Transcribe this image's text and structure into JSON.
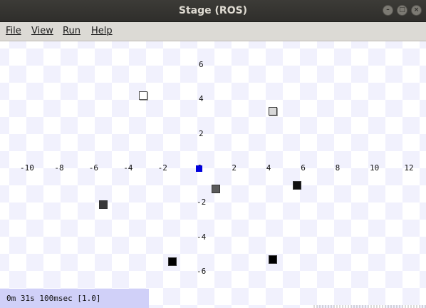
{
  "window": {
    "title": "Stage (ROS)"
  },
  "menu": [
    "File",
    "View",
    "Run",
    "Help"
  ],
  "axes": {
    "x_ticks": [
      -10,
      -8,
      -6,
      -4,
      -2,
      0,
      2,
      4,
      6,
      8,
      10,
      12
    ],
    "y_ticks": [
      6,
      4,
      2,
      -2,
      -4,
      -6
    ]
  },
  "robot": {
    "x": 0,
    "y": 0,
    "color": "#0000dd"
  },
  "objects": [
    {
      "x": -3.3,
      "y": 4.2,
      "color": "#ffffff"
    },
    {
      "x": 4.2,
      "y": 3.3,
      "color": "#d8d8d8"
    },
    {
      "x": 0.9,
      "y": -1.2,
      "color": "#5a5a5a"
    },
    {
      "x": 5.6,
      "y": -1.0,
      "color": "#111111"
    },
    {
      "x": -5.6,
      "y": -2.1,
      "color": "#3a3a3a"
    },
    {
      "x": -1.6,
      "y": -5.4,
      "color": "#000000"
    },
    {
      "x": 4.2,
      "y": -5.3,
      "color": "#000000"
    }
  ],
  "status": {
    "text": "0m 31s 100msec [1.0]"
  }
}
